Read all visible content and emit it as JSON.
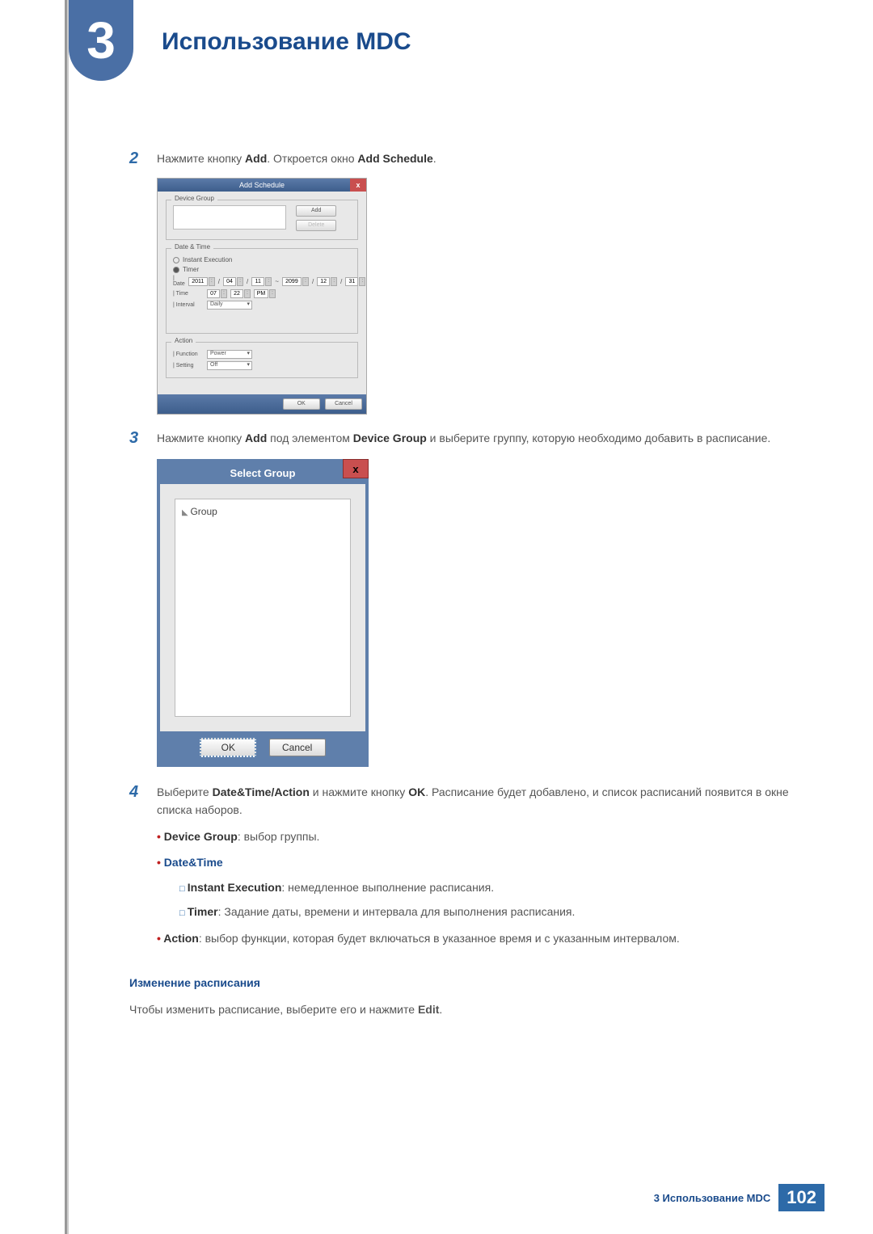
{
  "chapter": {
    "number": "3",
    "title": "Использование MDC"
  },
  "step2": {
    "num": "2",
    "text_pre": "Нажмите кнопку ",
    "bold1": "Add",
    "text_mid": ". Откроется окно ",
    "bold2": "Add Schedule",
    "text_post": "."
  },
  "addScheduleDialog": {
    "title": "Add Schedule",
    "close": "x",
    "deviceGroupLegend": "Device Group",
    "addBtn": "Add",
    "deleteBtn": "Delete",
    "dateTimeLegend": "Date & Time",
    "instantExecution": "Instant Execution",
    "timerRadio": "Timer",
    "dateLabel": "| Date",
    "date_y1": "2011",
    "date_m1": "04",
    "date_d1": "11",
    "dash": "~",
    "date_y2": "2099",
    "date_m2": "12",
    "date_d2": "31",
    "timeLabel": "| Time",
    "time_h": "07",
    "time_m": "22",
    "time_ampm": "PM",
    "intervalLabel": "| Interval",
    "intervalValue": "Daily",
    "actionLegend": "Action",
    "functionLabel": "| Function",
    "functionValue": "Power",
    "settingLabel": "| Setting",
    "settingValue": "Off",
    "okBtn": "OK",
    "cancelBtn": "Cancel"
  },
  "step3": {
    "num": "3",
    "t1": "Нажмите кнопку ",
    "b1": "Add",
    "t2": " под элементом ",
    "b2": "Device Group",
    "t3": " и выберите группу, которую необходимо добавить в расписание."
  },
  "selectGroupDialog": {
    "title": "Select Group",
    "close": "x",
    "item": "Group",
    "okBtn": "OK",
    "cancelBtn": "Cancel"
  },
  "step4": {
    "num": "4",
    "t1": "Выберите ",
    "b1": "Date&Time/Action",
    "t2": " и нажмите кнопку ",
    "b2": "OK",
    "t3": ". Расписание будет добавлено, и список расписаний появится в окне списка наборов."
  },
  "bullets": {
    "dg_b": "Device Group",
    "dg_t": ": выбор группы.",
    "dt_b": "Date&Time",
    "ie_b": "Instant Execution",
    "ie_t": ": немедленное выполнение расписания.",
    "tm_b": "Timer",
    "tm_t": ": Задание даты, времени и интервала для выполнения расписания.",
    "ac_b": "Action",
    "ac_t": ": выбор функции, которая будет включаться в указанное время и с указанным интервалом."
  },
  "subheading": "Изменение расписания",
  "editPara_t1": "Чтобы изменить расписание, выберите его и нажмите ",
  "editPara_b": "Edit",
  "editPara_t2": ".",
  "footer": {
    "label": "3  Использование MDC",
    "page": "102"
  }
}
